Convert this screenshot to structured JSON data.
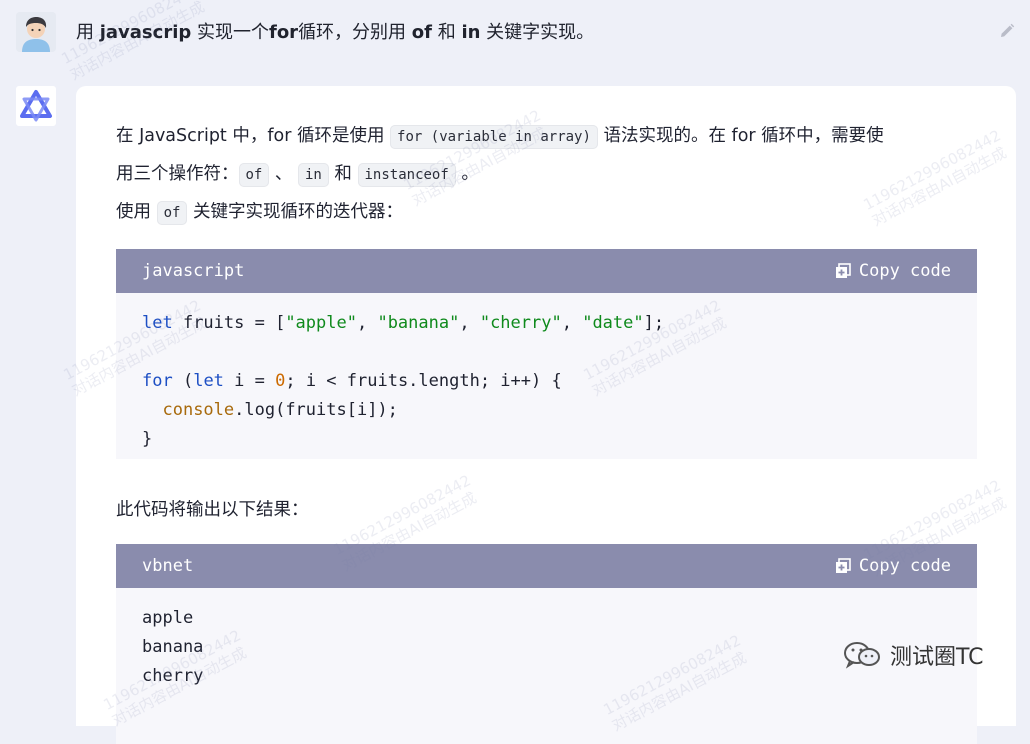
{
  "user": {
    "message_pre": "用 ",
    "message_b1": "javascrip",
    "message_mid1": " 实现一个",
    "message_b2": "for",
    "message_mid2": "循环，分别用 ",
    "message_b3": "of",
    "message_mid3": " 和 ",
    "message_b4": "in",
    "message_end": " 关键字实现。"
  },
  "answer": {
    "p1_a": "在 JavaScript 中，for 循环是使用 ",
    "p1_code": "for (variable in array)",
    "p1_b": " 语法实现的。在 for 循环中，需要使",
    "p2_a": "用三个操作符：",
    "p2_code1": "of",
    "p2_sep1": " 、 ",
    "p2_code2": "in",
    "p2_sep2": " 和 ",
    "p2_code3": "instanceof",
    "p2_end": " 。",
    "p3_a": "使用 ",
    "p3_code": "of",
    "p3_b": " 关键字实现循环的迭代器：",
    "p4": "此代码将输出以下结果："
  },
  "code1": {
    "language": "javascript",
    "copy_label": "Copy code",
    "l1_kw": "let",
    "l1_a": " fruits = [",
    "l1_s1": "\"apple\"",
    "l1_c1": ", ",
    "l1_s2": "\"banana\"",
    "l1_c2": ", ",
    "l1_s3": "\"cherry\"",
    "l1_c3": ", ",
    "l1_s4": "\"date\"",
    "l1_end": "];",
    "l3_kw1": "for",
    "l3_a": " (",
    "l3_kw2": "let",
    "l3_b": " i = ",
    "l3_num": "0",
    "l3_c": "; i < fruits.length; i++) {",
    "l4_indent": "  ",
    "l4_obj": "console",
    "l4_rest": ".log(fruits[i]);",
    "l5": "}"
  },
  "code2": {
    "language": "vbnet",
    "copy_label": "Copy code",
    "lines": [
      "apple",
      "banana",
      "cherry"
    ]
  },
  "watermark": {
    "line1": "11962129960824​42",
    "line2": "对话内容由AI自动生成"
  },
  "brand": {
    "text": "测试圈TC"
  },
  "colors": {
    "background": "#eef0f8",
    "code_header": "#8a8cad",
    "keyword": "#1d4fc4",
    "string": "#0f8a1c",
    "number": "#cc6a00"
  }
}
